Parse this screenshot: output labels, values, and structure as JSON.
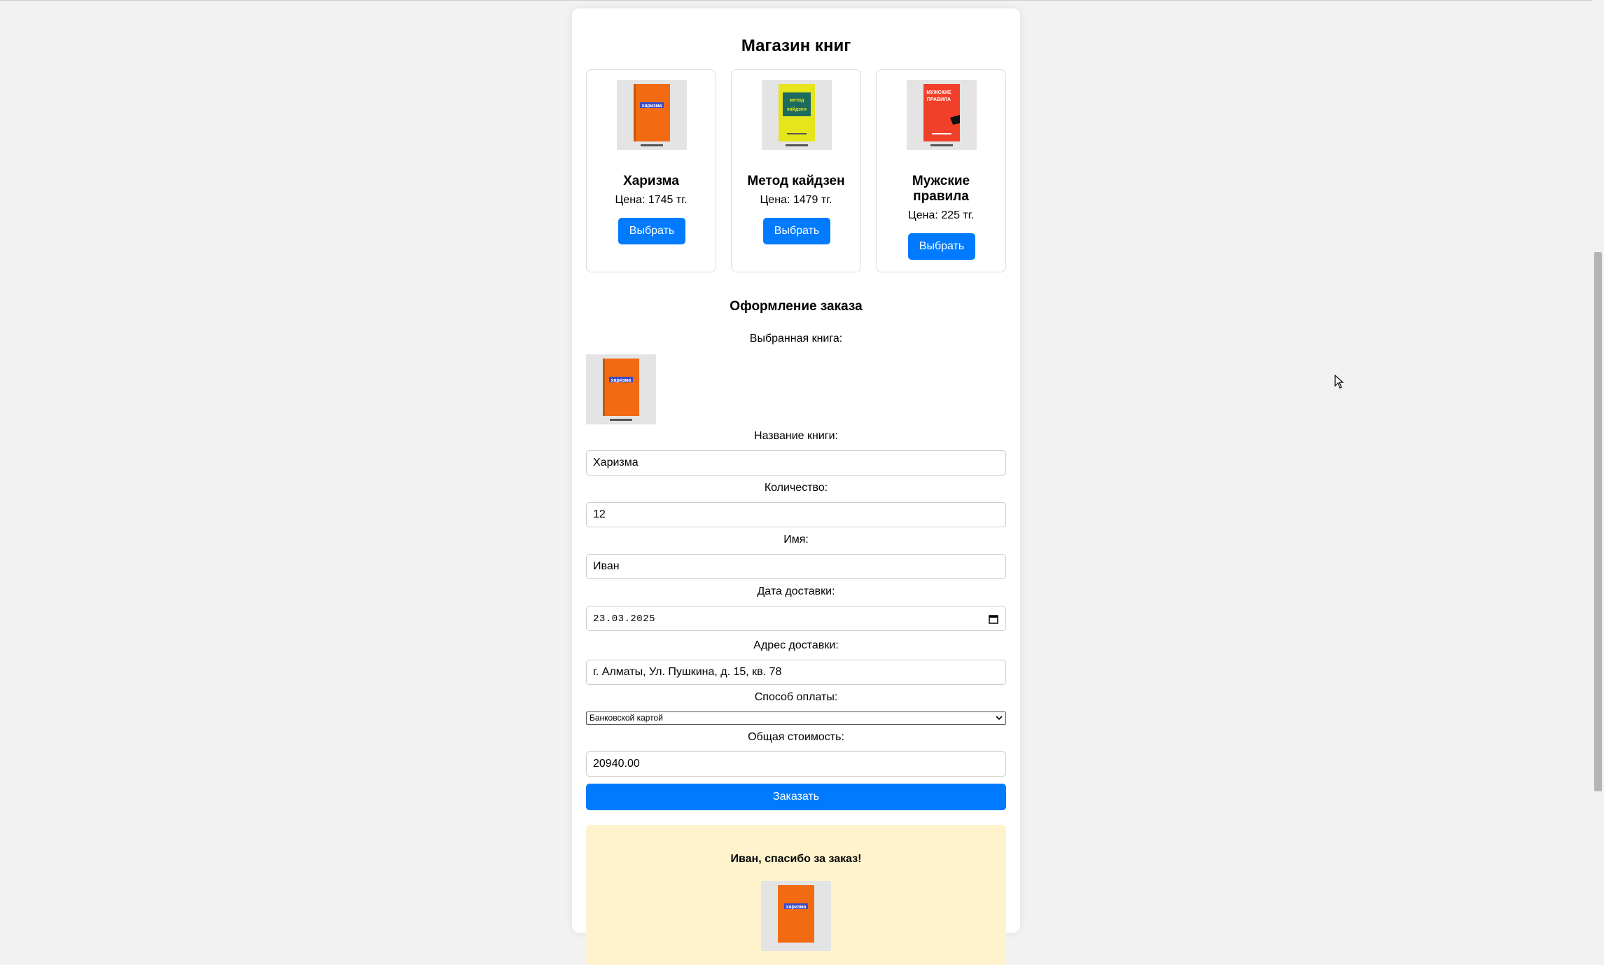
{
  "page": {
    "title": "Магазин книг"
  },
  "books": [
    {
      "name": "Харизма",
      "price": "Цена: 1745 тг.",
      "button": "Выбрать",
      "cover_color": "#f26a12",
      "cover_text": "харизма"
    },
    {
      "name": "Метод кайдзен",
      "price": "Цена: 1479 тг.",
      "button": "Выбрать",
      "cover_color": "#e6e51c",
      "cover_text": "метод кайдзен"
    },
    {
      "name": "Мужские правила",
      "price": "Цена: 225 тг.",
      "button": "Выбрать",
      "cover_color": "#f0402a",
      "cover_text": "мужские правила"
    }
  ],
  "order": {
    "title": "Оформление заказа",
    "selected_book_label": "Выбранная книга:",
    "book_name_label": "Название книги:",
    "book_name_value": "Харизма",
    "quantity_label": "Количество:",
    "quantity_value": "12",
    "name_label": "Имя:",
    "name_value": "Иван",
    "date_label": "Дата доставки:",
    "date_value": "23.03.2025",
    "address_label": "Адрес доставки:",
    "address_value": "г. Алматы, Ул. Пушкина, д. 15, кв. 78",
    "payment_label": "Способ оплаты:",
    "payment_value": "Банковской картой",
    "total_label": "Общая стоимость:",
    "total_value": "20940.00",
    "submit": "Заказать"
  },
  "confirmation": {
    "message": "Иван, спасибо за заказ!"
  },
  "colors": {
    "accent": "#007bff",
    "confirmation_bg": "#fff3cd"
  },
  "icons": {
    "date_picker": "calendar-icon",
    "select": "chevron-down-icon",
    "pointer": "mouse-cursor-icon"
  }
}
